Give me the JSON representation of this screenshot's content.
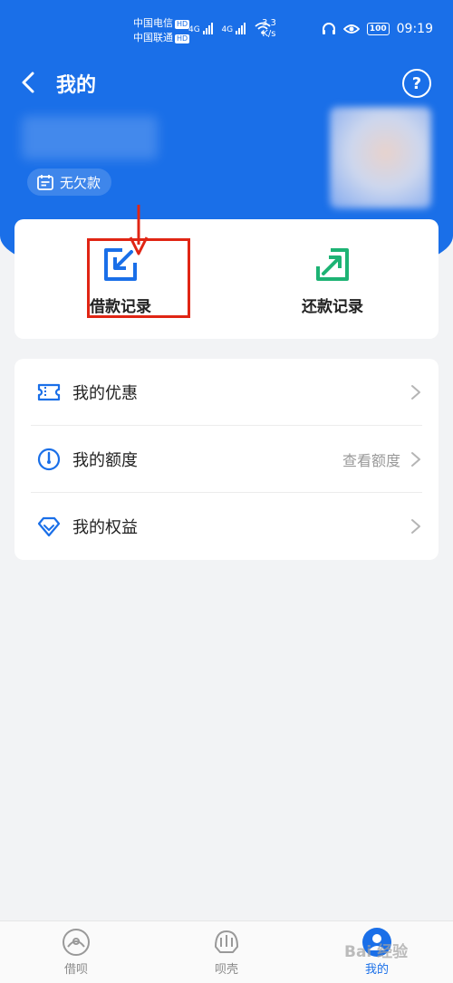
{
  "status_bar": {
    "carrier1": "中国电信",
    "carrier2": "中国联通",
    "hd": "HD",
    "network1": "4G",
    "network2": "4G",
    "speed_value": "3.3",
    "speed_unit": "K/s",
    "battery": "100",
    "time": "09:19"
  },
  "header": {
    "title": "我的",
    "help_glyph": "?",
    "badge_label": "无欠款"
  },
  "records": {
    "borrow_label": "借款记录",
    "repay_label": "还款记录"
  },
  "menu": {
    "items": [
      {
        "label": "我的优惠",
        "extra": ""
      },
      {
        "label": "我的额度",
        "extra": "查看额度"
      },
      {
        "label": "我的权益",
        "extra": ""
      }
    ]
  },
  "bottom_nav": {
    "items": [
      {
        "label": "借呗"
      },
      {
        "label": "呗壳"
      },
      {
        "label": "我的"
      }
    ]
  },
  "watermark": "Bai 经验",
  "colors": {
    "primary": "#1a6fe8",
    "repay_green": "#1db374",
    "highlight_red": "#e02514"
  }
}
